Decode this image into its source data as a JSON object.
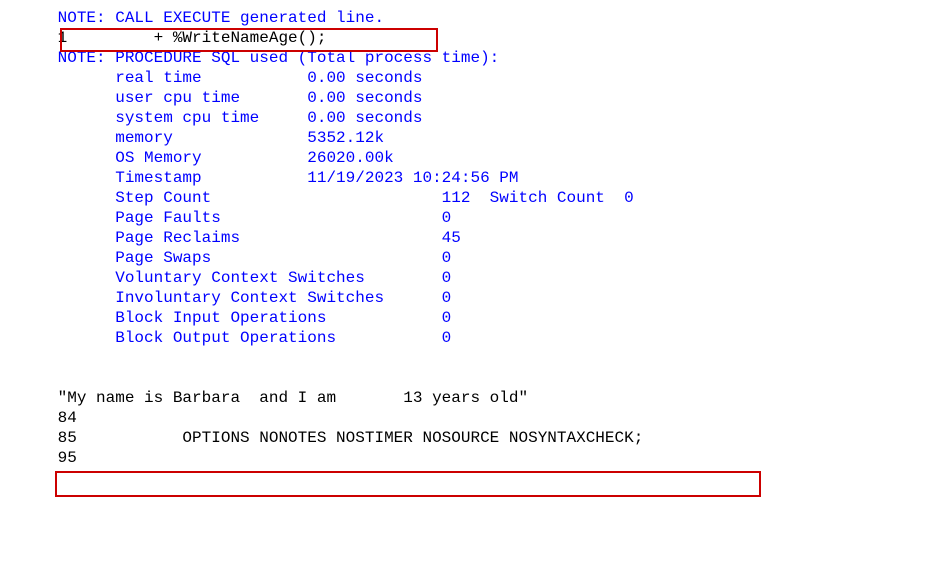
{
  "log": {
    "note_call": "NOTE: CALL EXECUTE generated line.",
    "genline": "1         + %WriteNameAge();",
    "note_proc": "NOTE: PROCEDURE SQL used (Total process time):",
    "stat_real": "      real time           0.00 seconds",
    "stat_user": "      user cpu time       0.00 seconds",
    "stat_sys": "      system cpu time     0.00 seconds",
    "stat_mem": "      memory              5352.12k",
    "stat_osmem": "      OS Memory           26020.00k",
    "stat_ts": "      Timestamp           11/19/2023 10:24:56 PM",
    "stat_step": "      Step Count                        112  Switch Count  0",
    "stat_pfaults": "      Page Faults                       0",
    "stat_preclaims": "      Page Reclaims                     45",
    "stat_pswaps": "      Page Swaps                        0",
    "stat_vcs": "      Voluntary Context Switches        0",
    "stat_ics": "      Involuntary Context Switches      0",
    "stat_bin": "      Block Input Operations            0",
    "stat_bout": "      Block Output Operations           0",
    "output_line": "\"My name is Barbara  and I am       13 years old\"",
    "ln84": "84",
    "ln85": "85           OPTIONS NONOTES NOSTIMER NOSOURCE NOSYNTAXCHECK;",
    "ln95": "95"
  },
  "chart_data": {
    "type": "table",
    "title": "PROCEDURE SQL used (Total process time)",
    "rows": [
      {
        "metric": "real time",
        "value": "0.00 seconds"
      },
      {
        "metric": "user cpu time",
        "value": "0.00 seconds"
      },
      {
        "metric": "system cpu time",
        "value": "0.00 seconds"
      },
      {
        "metric": "memory",
        "value": "5352.12k"
      },
      {
        "metric": "OS Memory",
        "value": "26020.00k"
      },
      {
        "metric": "Timestamp",
        "value": "11/19/2023 10:24:56 PM"
      },
      {
        "metric": "Step Count",
        "value": 112
      },
      {
        "metric": "Switch Count",
        "value": 0
      },
      {
        "metric": "Page Faults",
        "value": 0
      },
      {
        "metric": "Page Reclaims",
        "value": 45
      },
      {
        "metric": "Page Swaps",
        "value": 0
      },
      {
        "metric": "Voluntary Context Switches",
        "value": 0
      },
      {
        "metric": "Involuntary Context Switches",
        "value": 0
      },
      {
        "metric": "Block Input Operations",
        "value": 0
      },
      {
        "metric": "Block Output Operations",
        "value": 0
      }
    ],
    "generated_line": "+ %WriteNameAge();",
    "output_text": "My name is Barbara  and I am       13 years old"
  }
}
